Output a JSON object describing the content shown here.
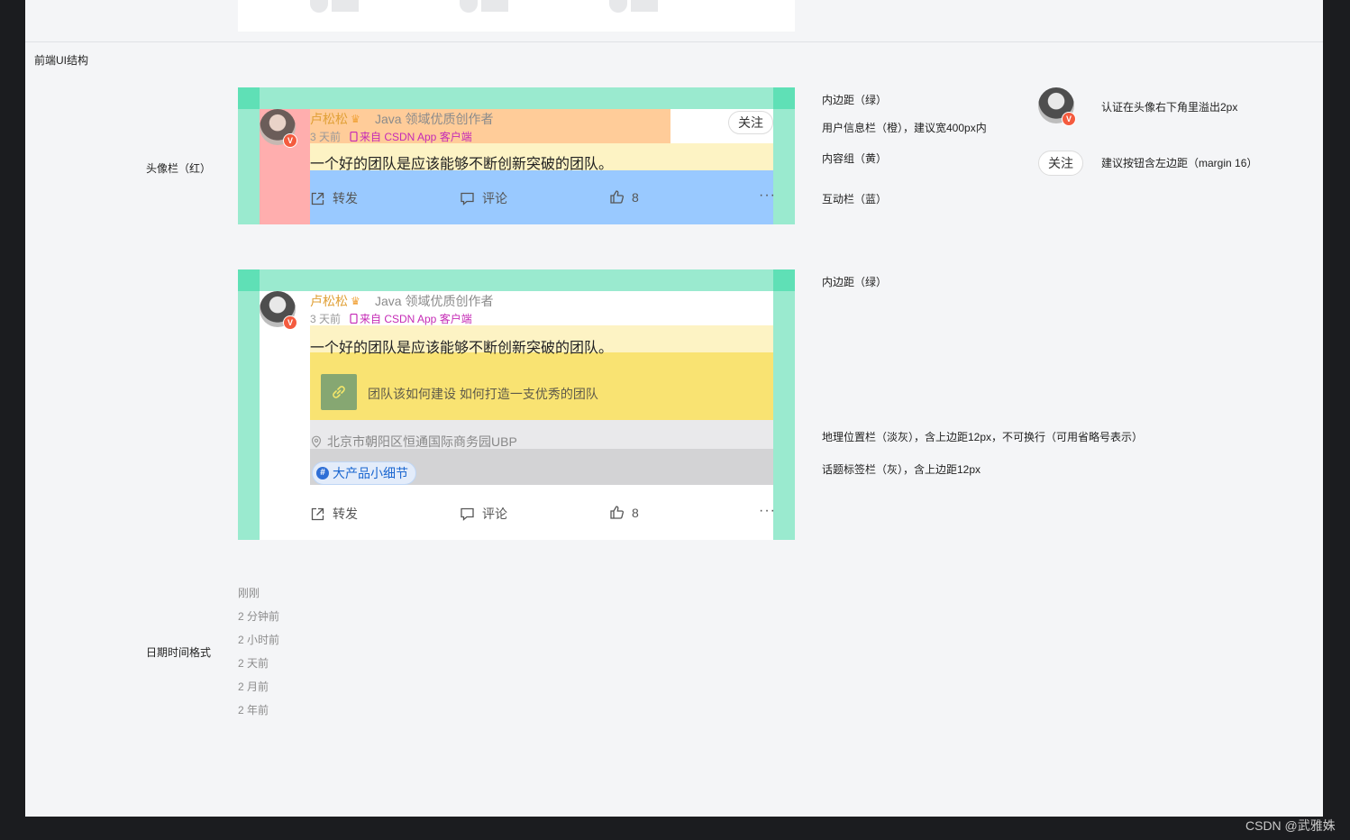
{
  "section_ui": "前端UI结构",
  "row_avatar_label": "头像栏（红）",
  "row_date_label": "日期时间格式",
  "post": {
    "name": "卢松松",
    "title": "Java 领域优质创作者",
    "time": "3 天前",
    "source": "来自 CSDN App 客户端",
    "content": "一个好的团队是应该能够不断创新突破的团队。",
    "follow": "关注",
    "actions": {
      "share": "转发",
      "comment": "评论",
      "like": "8",
      "more": "···"
    },
    "verified": "V"
  },
  "post2": {
    "link_title": "团队该如何建设 如何打造一支优秀的团队",
    "location": "北京市朝阳区恒通国际商务园UBP",
    "topic": "大产品小细节",
    "topic_icon": "#"
  },
  "annotations": {
    "padding": "内边距（绿）",
    "userinfo": "用户信息栏（橙），建议宽400px内",
    "content": "内容组（黄）",
    "interaction": "互动栏（蓝）",
    "padding2": "内边距（绿）",
    "location": "地理位置栏（淡灰），含上边距12px，不可换行（可用省略号表示）",
    "topic": "话题标签栏（灰），含上边距12px",
    "cert": "认证在头像右下角里溢出2px",
    "follow_btn": "关注",
    "follow_note": "建议按钮含左边距（margin 16）"
  },
  "time_formats": [
    "刚刚",
    "2 分钟前",
    "2 小时前",
    "2 天前",
    "2 月前",
    "2 年前"
  ],
  "watermark": "CSDN @武雅姝",
  "icons": [
    "share-icon",
    "comment-icon",
    "like-icon",
    "phone-icon",
    "link-icon",
    "location-icon",
    "crown-icon",
    "verified-icon"
  ]
}
